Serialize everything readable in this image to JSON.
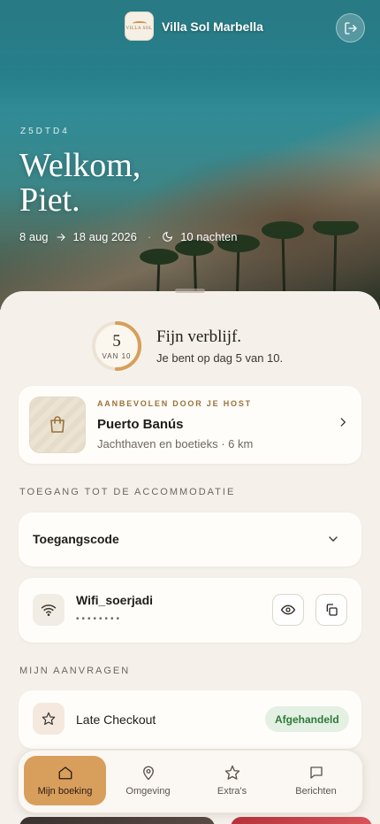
{
  "header": {
    "brand_name": "Villa Sol Marbella",
    "logo_text": "VILLA SOL"
  },
  "hero": {
    "booking_code": "Z5DTD4",
    "welcome_line1": "Welkom,",
    "welcome_line2": "Piet.",
    "check_in": "8 aug",
    "check_out": "18 aug 2026",
    "nights": "10 nachten"
  },
  "stay_progress": {
    "current_day": "5",
    "of_label": "VAN 10",
    "progress_fraction": 0.5,
    "title": "Fijn verblijf.",
    "subtitle": "Je bent op dag 5 van 10."
  },
  "recommendation": {
    "eyebrow": "AANBEVOLEN DOOR JE HOST",
    "title": "Puerto Banús",
    "subtitle": "Jachthaven en boetieks · 6 km"
  },
  "access": {
    "section_label": "TOEGANG TOT DE ACCOMMODATIE",
    "code_label": "Toegangscode",
    "wifi_name": "Wifi_soerjadi",
    "wifi_password_masked": "••••••••"
  },
  "requests": {
    "section_label": "MIJN AANVRAGEN",
    "items": [
      {
        "title": "Late Checkout",
        "status": "Afgehandeld"
      }
    ]
  },
  "nav": {
    "items": [
      {
        "label": "Mijn boeking",
        "icon": "home-icon",
        "active": true
      },
      {
        "label": "Omgeving",
        "icon": "map-pin-icon",
        "active": false
      },
      {
        "label": "Extra's",
        "icon": "star-icon",
        "active": false
      },
      {
        "label": "Berichten",
        "icon": "message-icon",
        "active": false
      }
    ]
  },
  "colors": {
    "accent": "#d89e5c",
    "background": "#f5f1ea",
    "success_bg": "#e3f0e3",
    "success_text": "#2f7a3a"
  }
}
